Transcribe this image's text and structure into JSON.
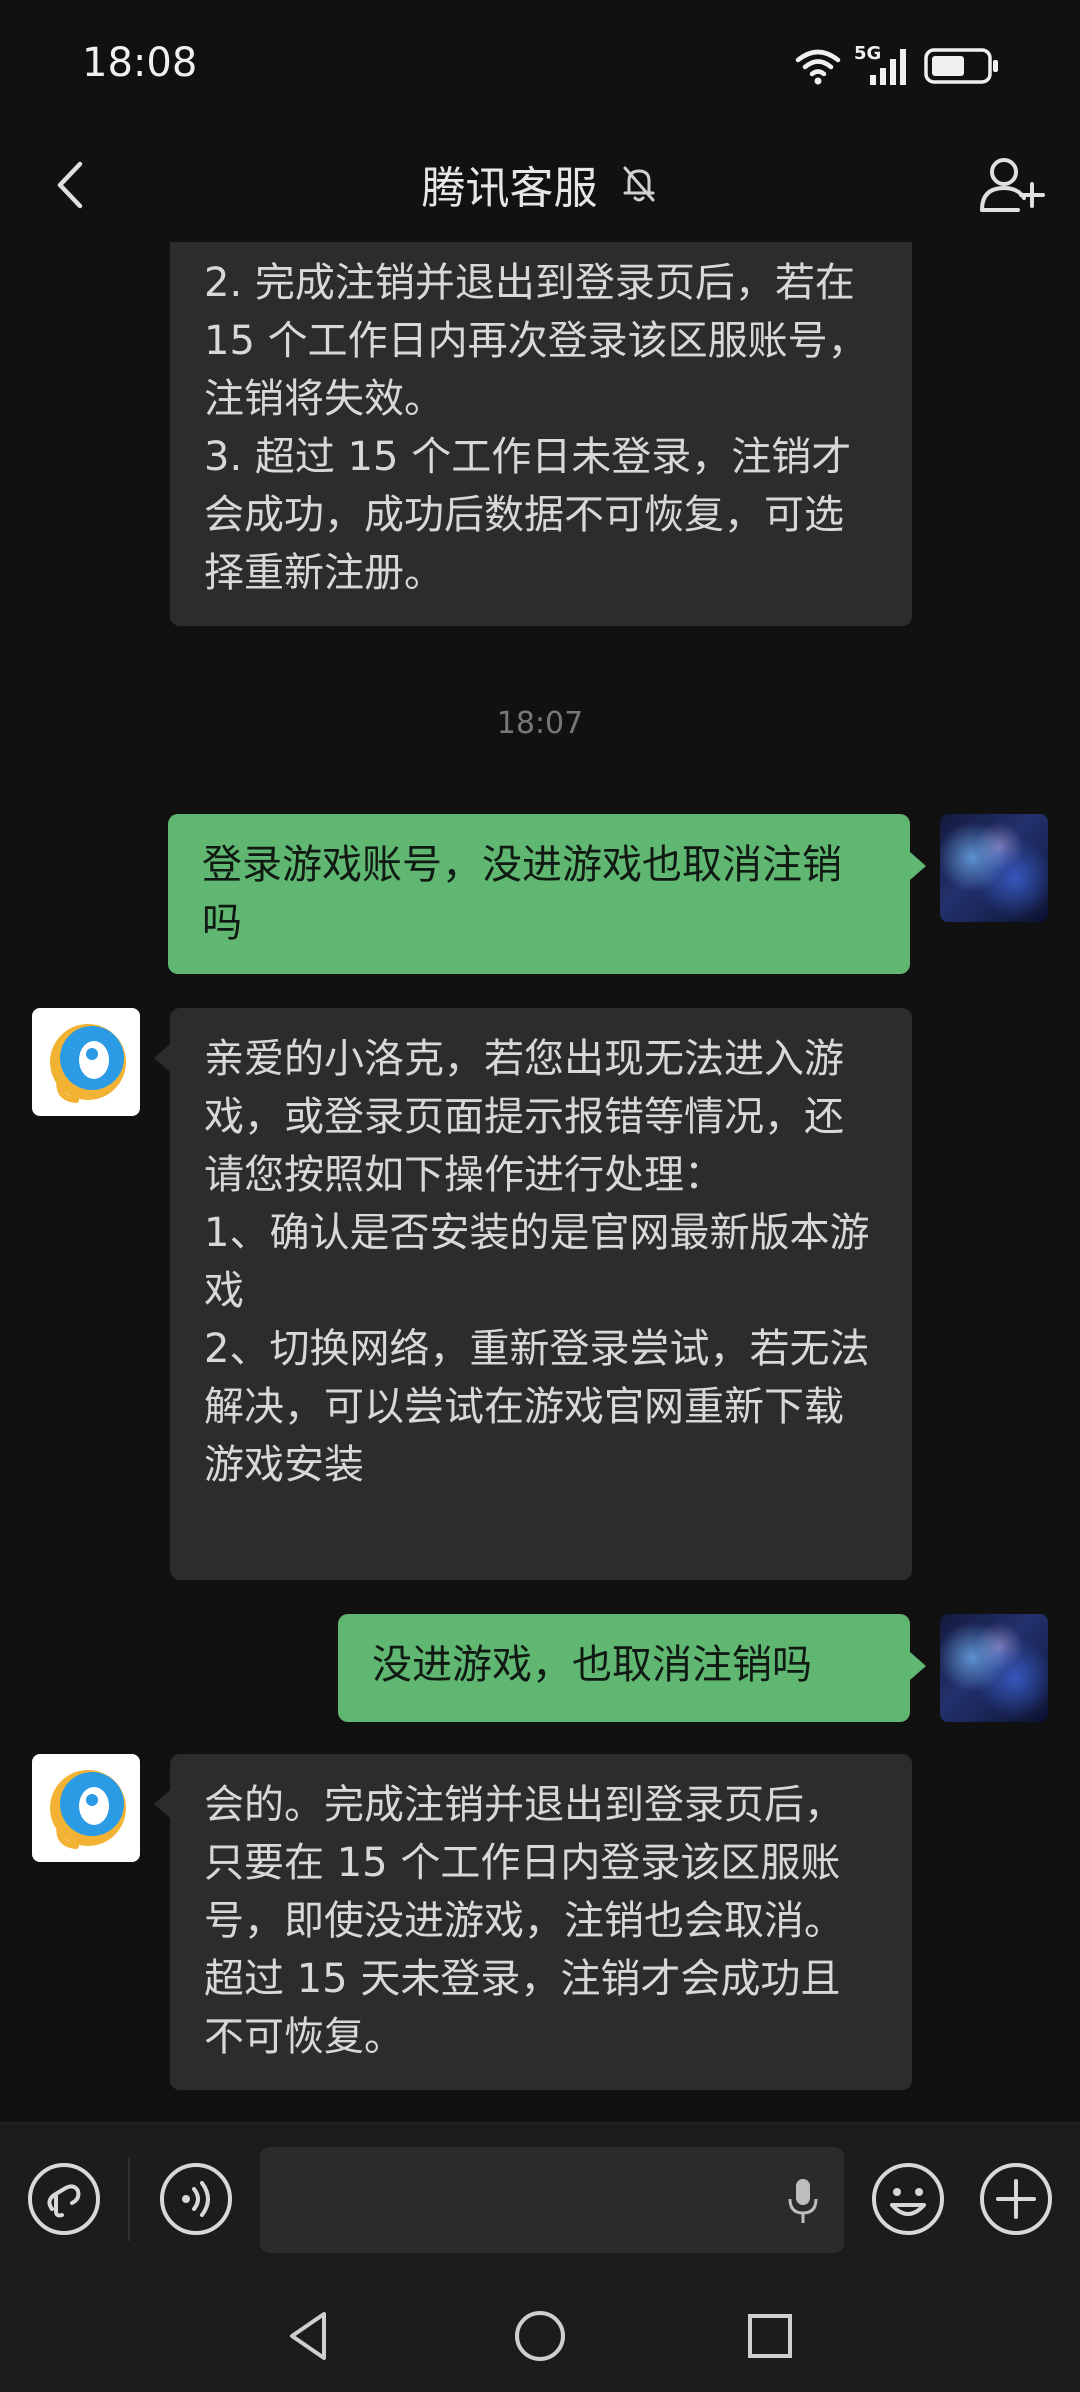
{
  "status_bar": {
    "time": "18:08",
    "network_label": "5G",
    "icons": [
      "wifi-icon",
      "cellular-signal-icon",
      "battery-icon"
    ],
    "battery_level": 0.6
  },
  "nav_bar": {
    "title": "腾讯客服",
    "back_icon": "chevron-left-icon",
    "mute_icon": "bell-off-icon",
    "add_icon": "add-contact-icon"
  },
  "chat": {
    "messages": [
      {
        "sender": "bot",
        "text": "2. 完成注销并退出到登录页后，若在 15 个工作日内再次登录该区服账号，注销将失效。\n3. 超过 15 个工作日未登录，注销才会成功，成功后数据不可恢复，可选择重新注册。"
      },
      {
        "sender": "system",
        "text": "18:07"
      },
      {
        "sender": "user",
        "text": "登录游戏账号，没进游戏也取消注销吗"
      },
      {
        "sender": "bot",
        "text": "亲爱的小洛克，若您出现无法进入游戏，或登录页面提示报错等情况，还请您按照如下操作进行处理：\n1、确认是否安装的是官网最新版本游戏\n2、切换网络，重新登录尝试，若无法解决，可以尝试在游戏官网重新下载游戏安装"
      },
      {
        "sender": "user",
        "text": "没进游戏，也取消注销吗"
      },
      {
        "sender": "bot",
        "text": "会的。完成注销并退出到登录页后，只要在 15 个工作日内登录该区服账号，即使没进游戏，注销也会取消。超过 15 天未登录，注销才会成功且不可恢复。"
      }
    ]
  },
  "input_bar": {
    "text_value": "",
    "icons": [
      "mini-program-icon",
      "voice-icon",
      "microphone-icon",
      "emoji-icon",
      "plus-icon"
    ]
  },
  "system_nav": {
    "icons": [
      "back-triangle-icon",
      "home-circle-icon",
      "recents-square-icon"
    ]
  },
  "colors": {
    "background": "#111111",
    "bubble_incoming": "#2c2c2c",
    "bubble_outgoing": "#5fb772",
    "bar_background": "#1c1c1c"
  }
}
